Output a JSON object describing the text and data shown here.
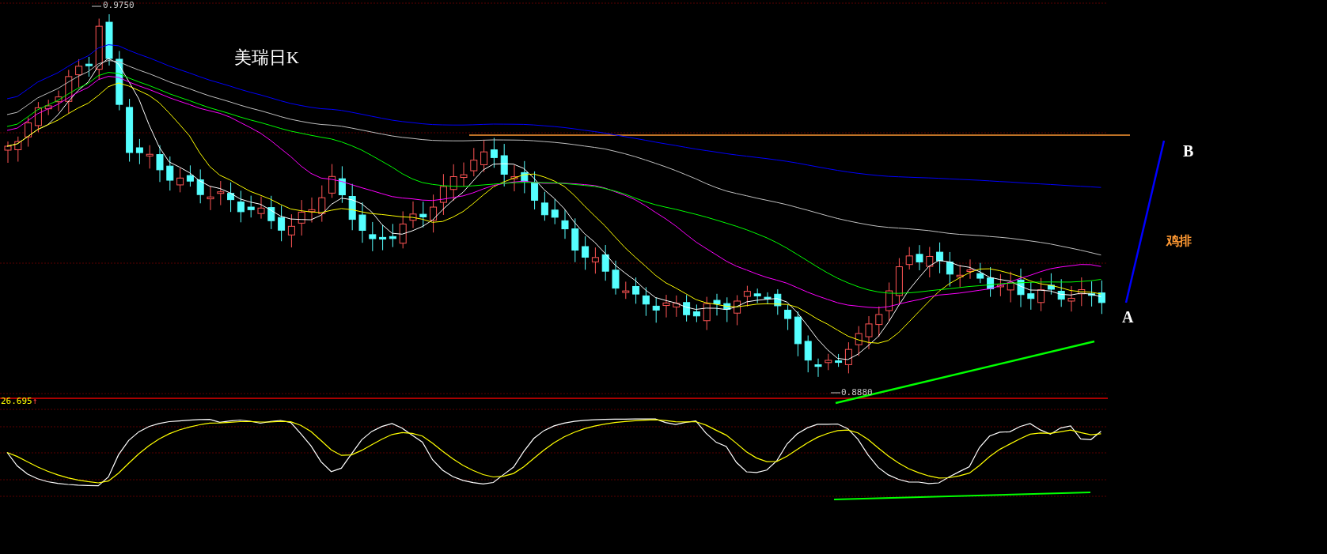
{
  "chart": {
    "title": "美瑞日K",
    "high_label": "0.9750",
    "low_label": "0.8880"
  },
  "indicator": {
    "reading": "26.695",
    "arrow": "↑"
  },
  "annotations": [
    {
      "kind": "point",
      "label": "B"
    },
    {
      "kind": "note",
      "label": "鸡排"
    },
    {
      "kind": "point",
      "label": "A"
    }
  ]
}
